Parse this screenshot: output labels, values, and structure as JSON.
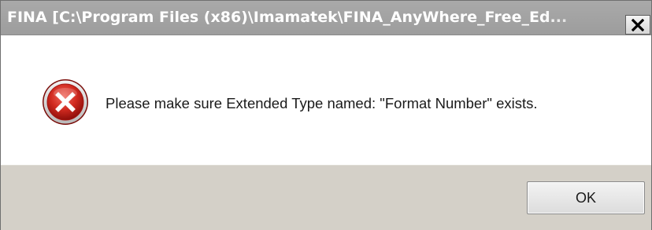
{
  "dialog": {
    "title": "FINA  [C:\\Program Files (x86)\\Imamatek\\FINA_AnyWhere_Free_Ed...",
    "close_button_label": "✕",
    "icon": "error-icon",
    "message": "Please make sure Extended Type named: \"Format Number\" exists.",
    "ok_label": "OK"
  },
  "colors": {
    "titlebar": "#a3a3a3",
    "title_text": "#ffffff",
    "content_bg": "#ffffff",
    "footer_bg": "#d4d0c8",
    "error_red": "#c8201a"
  }
}
